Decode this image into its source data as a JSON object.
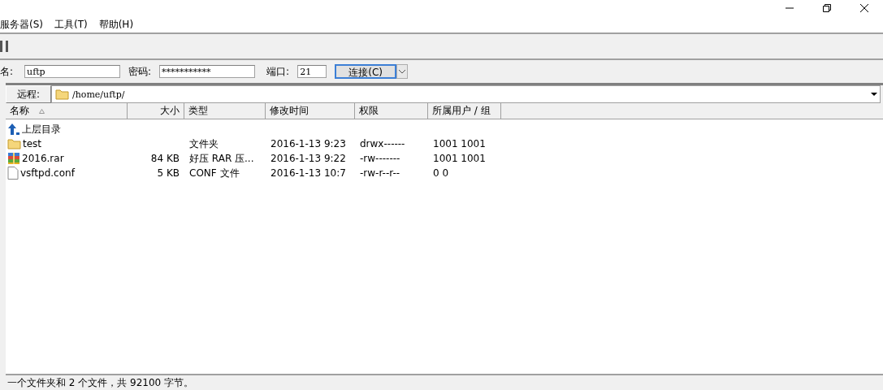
{
  "menu": [
    {
      "label": "服务器(S)"
    },
    {
      "label": "工具(T)"
    },
    {
      "label": "帮助(H)"
    }
  ],
  "login": {
    "user_label": "名:",
    "user_value": "uftp",
    "password_label": "密码:",
    "password_value": "***********",
    "port_label": "端口:",
    "port_value": "21",
    "connect": "连接(C)"
  },
  "remote": {
    "label": "远程:",
    "path": "/home/uftp/"
  },
  "table": {
    "columns": [
      {
        "label": "名称",
        "sorted": true
      },
      {
        "label": "大小",
        "sorted": false
      },
      {
        "label": "类型",
        "sorted": false
      },
      {
        "label": "修改时间",
        "sorted": false
      },
      {
        "label": "权限",
        "sorted": false
      },
      {
        "label": "所属用户 / 组",
        "sorted": false
      }
    ],
    "rows": [
      {
        "kind": "parent",
        "name": "上层目录"
      },
      {
        "kind": "folder",
        "name": "test",
        "size": "",
        "type": "文件夹",
        "modified": "2016-1-13 9:23",
        "perms": "drwx------",
        "owner": "1001 1001"
      },
      {
        "kind": "archive",
        "name": "2016.rar",
        "size": "84 KB",
        "type": "好压 RAR 压...",
        "modified": "2016-1-13 9:22",
        "perms": "-rw-------",
        "owner": "1001 1001"
      },
      {
        "kind": "file",
        "name": "vsftpd.conf",
        "size": "5 KB",
        "type": "CONF 文件",
        "modified": "2016-1-13 10:7",
        "perms": "-rw-r--r--",
        "owner": "0 0"
      }
    ]
  },
  "status_bar": "一个文件夹和 2 个文件，共 92100 字节。"
}
